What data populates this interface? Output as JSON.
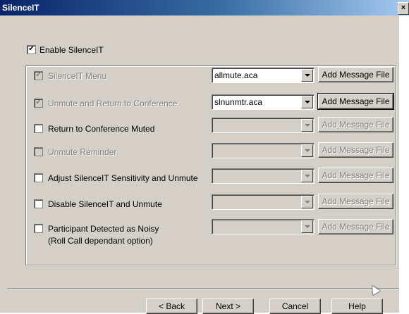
{
  "window": {
    "title": "SilenceIT",
    "close_icon": "×"
  },
  "enable": {
    "label": "Enable SilenceIT",
    "checked": true
  },
  "options": [
    {
      "label": "SilenceIT Menu",
      "checked": true,
      "enabled": false,
      "file": "allmute.aca",
      "add_label": "Add Message File",
      "row_enabled": true
    },
    {
      "label": "Unmute and Return to Conference",
      "checked": true,
      "enabled": false,
      "file": "slnunmtr.aca",
      "add_label": "Add Message File",
      "row_enabled": true
    },
    {
      "label": "Return to Conference Muted",
      "checked": false,
      "enabled": true,
      "file": "",
      "add_label": "Add Message File",
      "row_enabled": false
    },
    {
      "label": "Unmute Reminder",
      "checked": false,
      "enabled": false,
      "file": "",
      "add_label": "Add Message File",
      "row_enabled": false
    },
    {
      "label": "Adjust SilenceIT Sensitivity and Unmute",
      "checked": false,
      "enabled": true,
      "file": "",
      "add_label": "Add Message File",
      "row_enabled": false
    },
    {
      "label": "Disable SilenceIT and Unmute",
      "checked": false,
      "enabled": true,
      "file": "",
      "add_label": "Add Message File",
      "row_enabled": false
    },
    {
      "label": "Participant Detected as Noisy",
      "label2": "(Roll Call dependant option)",
      "checked": false,
      "enabled": true,
      "file": "",
      "add_label": "Add Message File",
      "row_enabled": false
    }
  ],
  "buttons": {
    "back": "< Back",
    "next": "Next >",
    "cancel": "Cancel",
    "help": "Help"
  },
  "colors": {
    "face": "#d4d0c8",
    "title_start": "#0a246a",
    "title_end": "#a6caf0"
  }
}
